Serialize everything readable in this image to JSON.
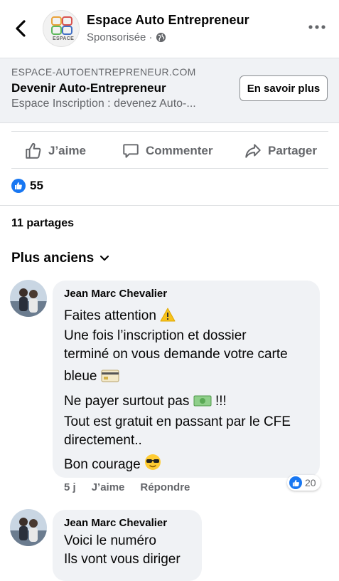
{
  "header": {
    "page_name": "Espace Auto Entrepreneur",
    "sponsored": "Sponsorisée ·",
    "logo_text": "ESPACE"
  },
  "link_preview": {
    "domain": "ESPACE-AUTOENTREPRENEUR.COM",
    "title": "Devenir Auto-Entrepreneur",
    "description": "Espace Inscription : devenez Auto-...",
    "cta_label": "En savoir plus"
  },
  "actions": {
    "like": "J’aime",
    "comment": "Commenter",
    "share": "Partager"
  },
  "stats": {
    "reactions_count": "55",
    "shares": "11 partages"
  },
  "sort": {
    "label": "Plus anciens"
  },
  "comments": [
    {
      "author": "Jean Marc Chevalier",
      "lines": [
        "Faites attention",
        "Une fois l’inscription et dossier",
        "terminé on vous demande votre carte",
        "bleue",
        "Ne payer surtout pas",
        "Tout est gratuit en passant par le CFE",
        "directement..",
        "Bon courage"
      ],
      "suffix_5": "!!!",
      "time": "5 j",
      "like_label": "J’aime",
      "reply_label": "Répondre",
      "reaction_count": "20"
    },
    {
      "author": "Jean Marc Chevalier",
      "lines": [
        "Voici le numéro",
        "Ils vont vous diriger"
      ]
    }
  ],
  "colors": {
    "brand_blue": "#1877f2",
    "secondary_text": "#65676b",
    "bubble_bg": "#f0f2f5"
  }
}
